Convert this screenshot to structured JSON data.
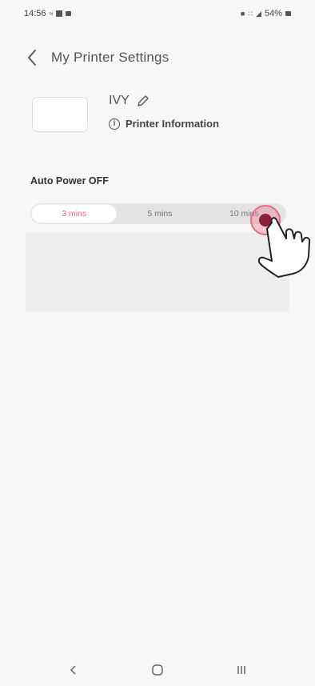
{
  "status_bar": {
    "time": "14:56",
    "battery": "54%"
  },
  "header": {
    "title": "My Printer Settings",
    "back_icon": "chevron-left-icon"
  },
  "printer": {
    "name": "IVY",
    "info_label": "Printer Information",
    "edit_icon": "pencil-icon",
    "info_icon": "info-circle-icon"
  },
  "auto_power": {
    "label": "Auto Power OFF",
    "options": [
      "3 mins",
      "5 mins",
      "10 mins"
    ],
    "selected": "3 mins",
    "accent": "#e26688"
  },
  "nav": {
    "back": "<",
    "home": "O",
    "recents": "III"
  }
}
